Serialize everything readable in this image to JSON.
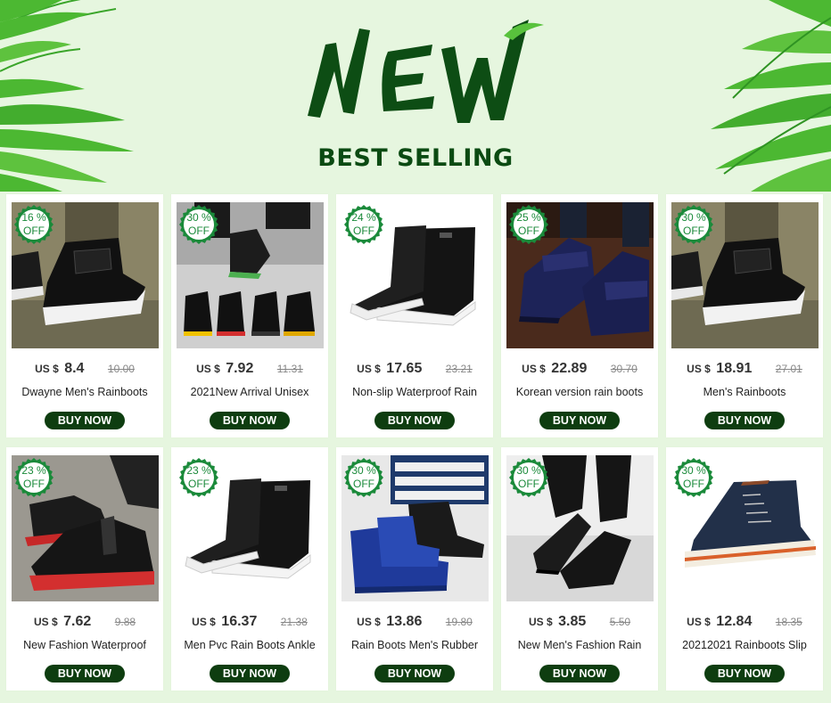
{
  "header": {
    "new_title": "NEW",
    "best_selling": "BEST SELLING"
  },
  "currency": "US $",
  "buy_label": "BUY NOW",
  "colors": {
    "background": "#e6f6df",
    "dark_green": "#0b4a12",
    "button_bg": "#0e3d10",
    "badge_green": "#1a8a3a"
  },
  "products": [
    {
      "discount": "16 %",
      "off": "OFF",
      "price": "8.4",
      "old_price": "10.00",
      "name": "Dwayne Men's Rainboots",
      "image": "black-ankle-boot-on-step"
    },
    {
      "discount": "30 %",
      "off": "OFF",
      "price": "7.92",
      "old_price": "11.31",
      "name": "2021New Arrival Unisex",
      "image": "row-of-rain-boots-with-colored-soles"
    },
    {
      "discount": "24 %",
      "off": "OFF",
      "price": "17.65",
      "old_price": "23.21",
      "name": "Non-slip Waterproof Rain",
      "image": "black-mid-calf-rain-boot"
    },
    {
      "discount": "25 %",
      "off": "OFF",
      "price": "22.89",
      "old_price": "30.70",
      "name": "Korean version rain boots",
      "image": "navy-strap-ankle-boots"
    },
    {
      "discount": "30 %",
      "off": "OFF",
      "price": "18.91",
      "old_price": "27.01",
      "name": "Men's Rainboots",
      "image": "black-ankle-boot-on-step"
    },
    {
      "discount": "23 %",
      "off": "OFF",
      "price": "7.62",
      "old_price": "9.88",
      "name": "New Fashion Waterproof",
      "image": "black-ankle-boots-red-soles"
    },
    {
      "discount": "23 %",
      "off": "OFF",
      "price": "16.37",
      "old_price": "21.38",
      "name": "Men Pvc Rain Boots Ankle",
      "image": "black-mid-calf-rain-boot"
    },
    {
      "discount": "30 %",
      "off": "OFF",
      "price": "13.86",
      "old_price": "19.80",
      "name": "Rain Boots Men's Rubber",
      "image": "blue-and-black-boots-with-poster"
    },
    {
      "discount": "30 %",
      "off": "OFF",
      "price": "3.85",
      "old_price": "5.50",
      "name": "New Men's Fashion Rain",
      "image": "black-slip-on-shoes"
    },
    {
      "discount": "30 %",
      "off": "OFF",
      "price": "12.84",
      "old_price": "18.35",
      "name": "20212021 Rainboots Slip",
      "image": "navy-lace-up-high-top-shoe"
    }
  ]
}
